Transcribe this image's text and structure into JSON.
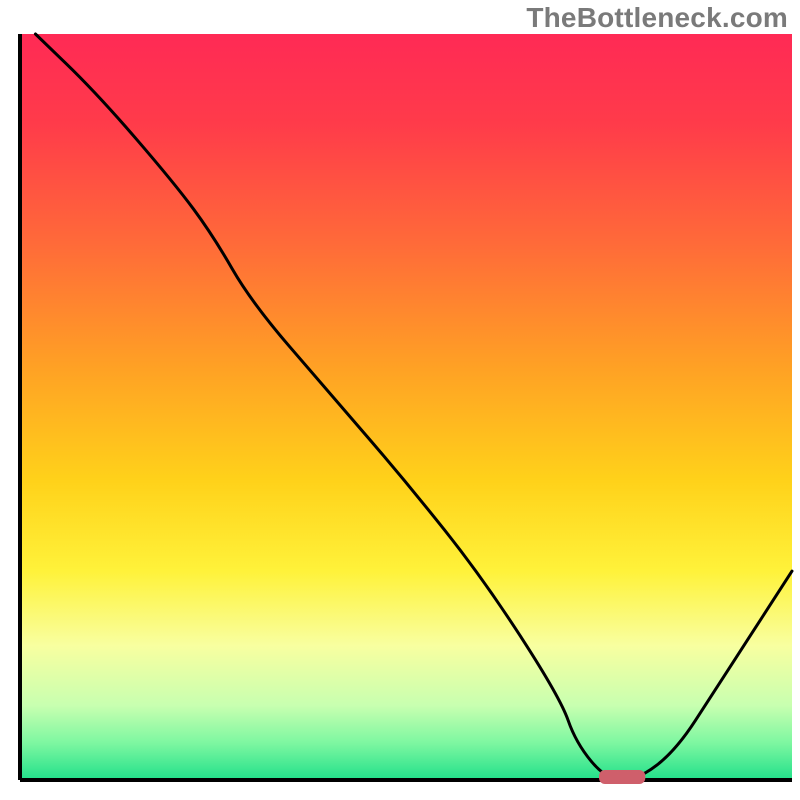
{
  "watermark": "TheBottleneck.com",
  "chart_data": {
    "type": "line",
    "title": "",
    "xlabel": "",
    "ylabel": "",
    "xlim": [
      0,
      100
    ],
    "ylim": [
      0,
      100
    ],
    "x": [
      2,
      10,
      20,
      25,
      30,
      40,
      50,
      60,
      70,
      72,
      76,
      80,
      85,
      90,
      95,
      100
    ],
    "values": [
      100,
      92,
      80,
      73,
      64,
      52,
      40,
      27,
      11,
      5,
      0,
      0,
      4,
      12,
      20,
      28
    ],
    "marker": {
      "x": 78,
      "y": 0,
      "width": 6,
      "height": 1.2,
      "color": "#cf5f6b"
    },
    "gradient_stops": [
      {
        "offset": 0.0,
        "color": "#ff2a55"
      },
      {
        "offset": 0.12,
        "color": "#ff3b4a"
      },
      {
        "offset": 0.28,
        "color": "#ff6a39"
      },
      {
        "offset": 0.45,
        "color": "#ffa224"
      },
      {
        "offset": 0.6,
        "color": "#ffd21a"
      },
      {
        "offset": 0.72,
        "color": "#fff23a"
      },
      {
        "offset": 0.82,
        "color": "#f8ffa0"
      },
      {
        "offset": 0.9,
        "color": "#c8ffb0"
      },
      {
        "offset": 0.95,
        "color": "#7ef7a1"
      },
      {
        "offset": 1.0,
        "color": "#21e08a"
      }
    ],
    "axis_color": "#000000",
    "line_color": "#000000",
    "line_width": 3
  }
}
